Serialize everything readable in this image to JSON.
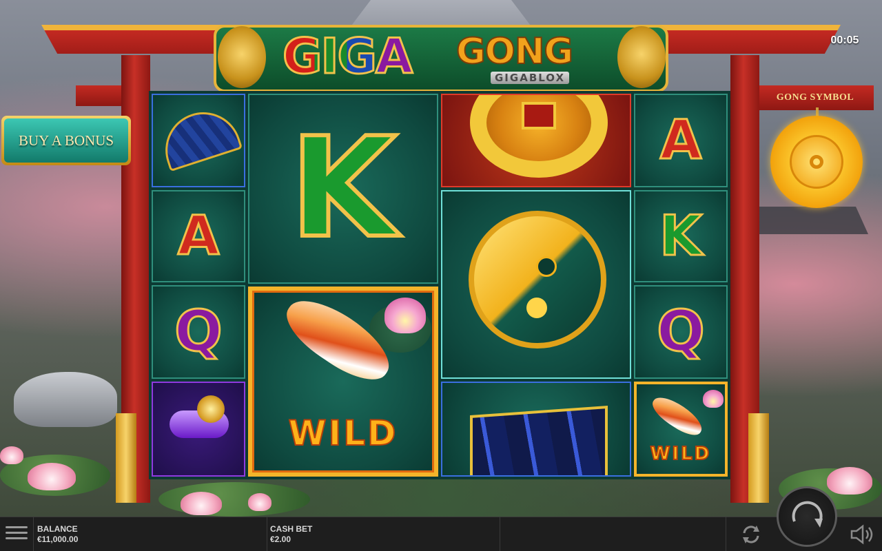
{
  "game": {
    "title_giga": "GIGA",
    "title_gong": "GONG",
    "subtitle": "GIGABLOX"
  },
  "timer": "00:05",
  "buy_bonus_label": "BUY A BONUS",
  "gong_symbol_label": "GONG SYMBOL",
  "reels": {
    "wild_label": "WILD",
    "symbols": {
      "a": "A",
      "k": "K",
      "q": "Q"
    }
  },
  "bottom_bar": {
    "balance_label": "BALANCE",
    "balance_value": "€11,000.00",
    "cash_bet_label": "CASH BET",
    "cash_bet_value": "€2.00"
  },
  "icons": [
    "menu-icon",
    "autoplay-icon",
    "spin-icon",
    "sound-icon"
  ],
  "colors": {
    "torii_red": "#c42a22",
    "gold": "#f2c24a",
    "reel_green": "#0f4a40",
    "bar_bg": "#1e1e1e"
  }
}
